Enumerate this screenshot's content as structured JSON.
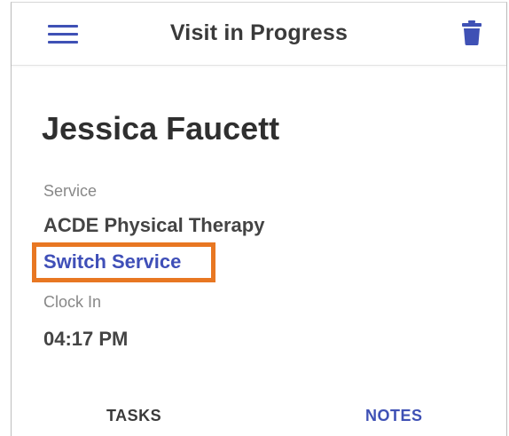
{
  "app_bar": {
    "title": "Visit in Progress",
    "menu_icon": "hamburger-menu-icon",
    "delete_icon": "trash-icon",
    "accent_color": "#3f51b5"
  },
  "visit": {
    "client_name": "Jessica Faucett",
    "service_label": "Service",
    "service_value": "ACDE Physical Therapy",
    "switch_service_link": "Switch Service",
    "clock_in_label": "Clock In",
    "clock_in_value": "04:17 PM"
  },
  "highlight": {
    "color": "#e87722",
    "target": "switch_service_link"
  },
  "tabs": [
    {
      "label": "TASKS",
      "active": false
    },
    {
      "label": "NOTES",
      "active": true
    }
  ]
}
